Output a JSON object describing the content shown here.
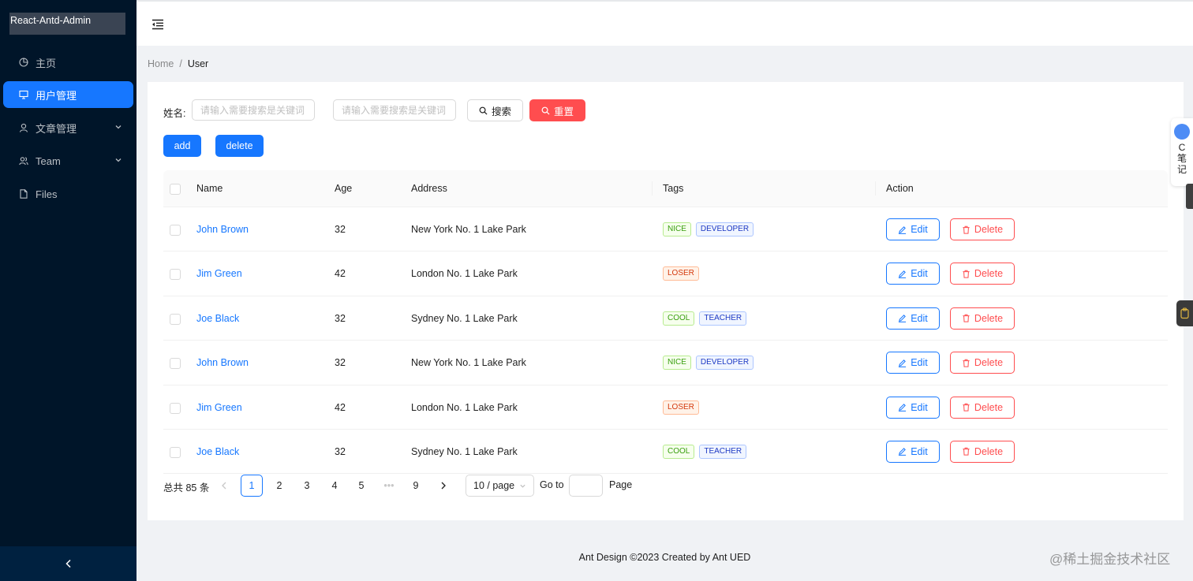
{
  "app": {
    "logo_text": "React-Antd-Admin"
  },
  "sidebar": {
    "items": [
      {
        "label": "主页",
        "icon": "pie-chart-icon",
        "selected": false,
        "has_submenu": false
      },
      {
        "label": "用户管理",
        "icon": "desktop-icon",
        "selected": true,
        "has_submenu": false
      },
      {
        "label": "文章管理",
        "icon": "user-icon",
        "selected": false,
        "has_submenu": true
      },
      {
        "label": "Team",
        "icon": "team-icon",
        "selected": false,
        "has_submenu": true
      },
      {
        "label": "Files",
        "icon": "file-icon",
        "selected": false,
        "has_submenu": false
      }
    ],
    "collapse_icon": "chevron-left-icon"
  },
  "header": {
    "menu_fold_icon": "menu-fold-icon"
  },
  "breadcrumb": {
    "home": "Home",
    "separator": "/",
    "current": "User"
  },
  "search": {
    "label": "姓名:",
    "input1_placeholder": "请输入需要搜索是关键词",
    "input2_placeholder": "请输入需要搜索是关键词",
    "search_button": "搜索",
    "reset_button": "重置"
  },
  "toolbar": {
    "add_label": "add",
    "delete_label": "delete"
  },
  "table": {
    "columns": [
      "Name",
      "Age",
      "Address",
      "Tags",
      "Action"
    ],
    "rows": [
      {
        "name": "John Brown",
        "age": "32",
        "address": "New York No. 1 Lake Park",
        "tags": [
          {
            "text": "NICE",
            "color": "green"
          },
          {
            "text": "DEVELOPER",
            "color": "geekblue"
          }
        ]
      },
      {
        "name": "Jim Green",
        "age": "42",
        "address": "London No. 1 Lake Park",
        "tags": [
          {
            "text": "LOSER",
            "color": "volcano"
          }
        ]
      },
      {
        "name": "Joe Black",
        "age": "32",
        "address": "Sydney No. 1 Lake Park",
        "tags": [
          {
            "text": "COOL",
            "color": "green"
          },
          {
            "text": "TEACHER",
            "color": "geekblue"
          }
        ]
      },
      {
        "name": "John Brown",
        "age": "32",
        "address": "New York No. 1 Lake Park",
        "tags": [
          {
            "text": "NICE",
            "color": "green"
          },
          {
            "text": "DEVELOPER",
            "color": "geekblue"
          }
        ]
      },
      {
        "name": "Jim Green",
        "age": "42",
        "address": "London No. 1 Lake Park",
        "tags": [
          {
            "text": "LOSER",
            "color": "volcano"
          }
        ]
      },
      {
        "name": "Joe Black",
        "age": "32",
        "address": "Sydney No. 1 Lake Park",
        "tags": [
          {
            "text": "COOL",
            "color": "green"
          },
          {
            "text": "TEACHER",
            "color": "geekblue"
          }
        ]
      }
    ],
    "edit_label": "Edit",
    "delete_label": "Delete"
  },
  "pagination": {
    "total_text": "总共 85 条",
    "pages": [
      "1",
      "2",
      "3",
      "4",
      "5",
      "•••",
      "9"
    ],
    "current_page": "1",
    "page_size": "10 / page",
    "goto_label": "Go to",
    "page_label": "Page"
  },
  "footer": {
    "text": "Ant Design ©2023 Created by Ant UED"
  },
  "watermark": {
    "text": "@稀土掘金技术社区"
  },
  "side_widget": {
    "text": "C笔记"
  },
  "colors": {
    "primary": "#1677ff",
    "danger": "#ff4d4f",
    "sider_bg": "#001529"
  }
}
